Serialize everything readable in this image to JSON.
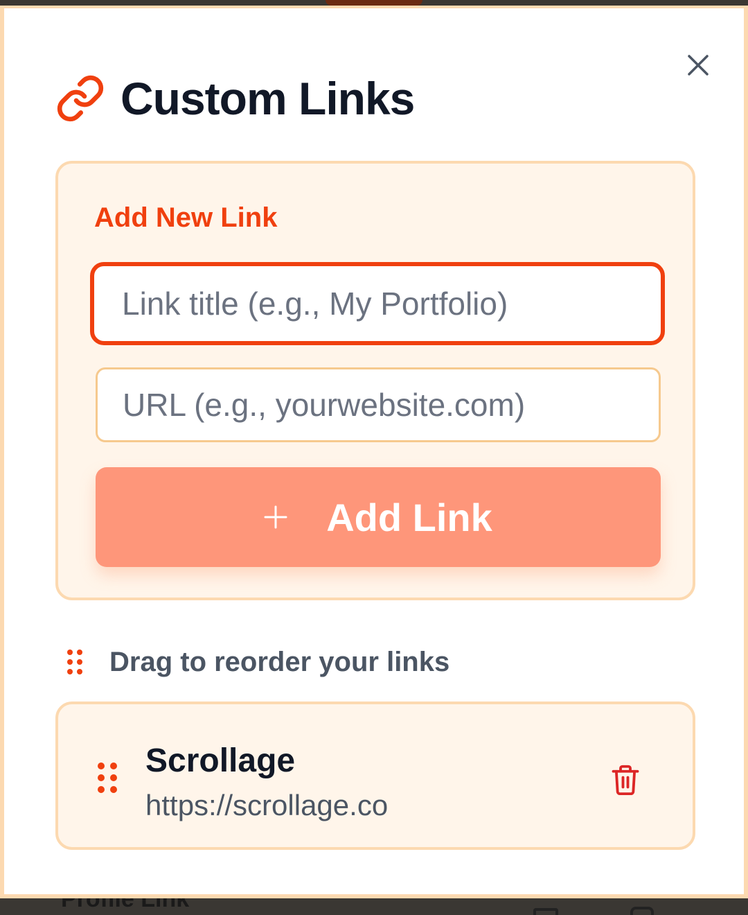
{
  "background": {
    "peek_text": "Profile Link"
  },
  "modal": {
    "title": "Custom Links",
    "close_label": "Close"
  },
  "add_form": {
    "section_title": "Add New Link",
    "title_placeholder": "Link title (e.g., My Portfolio)",
    "title_value": "",
    "url_placeholder": "URL (e.g., yourwebsite.com)",
    "url_value": "",
    "button_icon": "plus-icon",
    "button_label": "Add Link"
  },
  "hint": {
    "icon": "grip-dots-icon",
    "text": "Drag to reorder your links"
  },
  "links": [
    {
      "title": "Scrollage",
      "url": "https://scrollage.co"
    }
  ],
  "colors": {
    "accent": "#f0400f",
    "button_bg": "#fe967a",
    "card_bg": "#fff5ea",
    "card_border": "#fcd9b0",
    "heading": "#111827",
    "delete": "#dc2626"
  }
}
